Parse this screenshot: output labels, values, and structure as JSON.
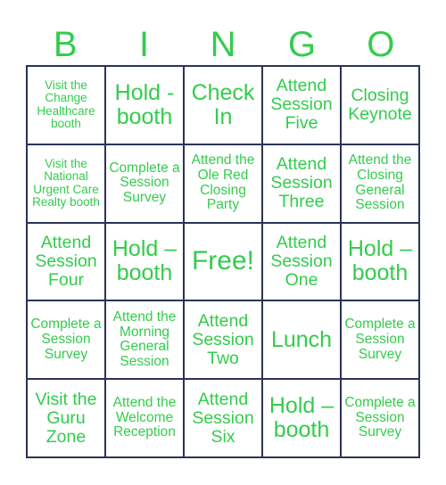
{
  "header": [
    "B",
    "I",
    "N",
    "G",
    "O"
  ],
  "colors": {
    "text": "#33cc4d",
    "border": "#2b3358"
  },
  "cells": [
    [
      "Visit the Change Healthcare booth",
      "Hold - booth",
      "Check In",
      "Attend Session Five",
      "Closing Keynote"
    ],
    [
      "Visit the National Urgent Care Realty booth",
      "Complete a Session Survey",
      "Attend the Ole Red Closing Party",
      "Attend Session Three",
      "Attend the Closing General Session"
    ],
    [
      "Attend Session Four",
      "Hold – booth",
      "Free!",
      "Attend Session One",
      "Hold – booth"
    ],
    [
      "Complete a Session Survey",
      "Attend the Morning General Session",
      "Attend Session Two",
      "Lunch",
      "Complete a Session Survey"
    ],
    [
      "Visit the Guru Zone",
      "Attend the Welcome Reception",
      "Attend Session Six",
      "Hold – booth",
      "Complete a Session Survey"
    ]
  ]
}
